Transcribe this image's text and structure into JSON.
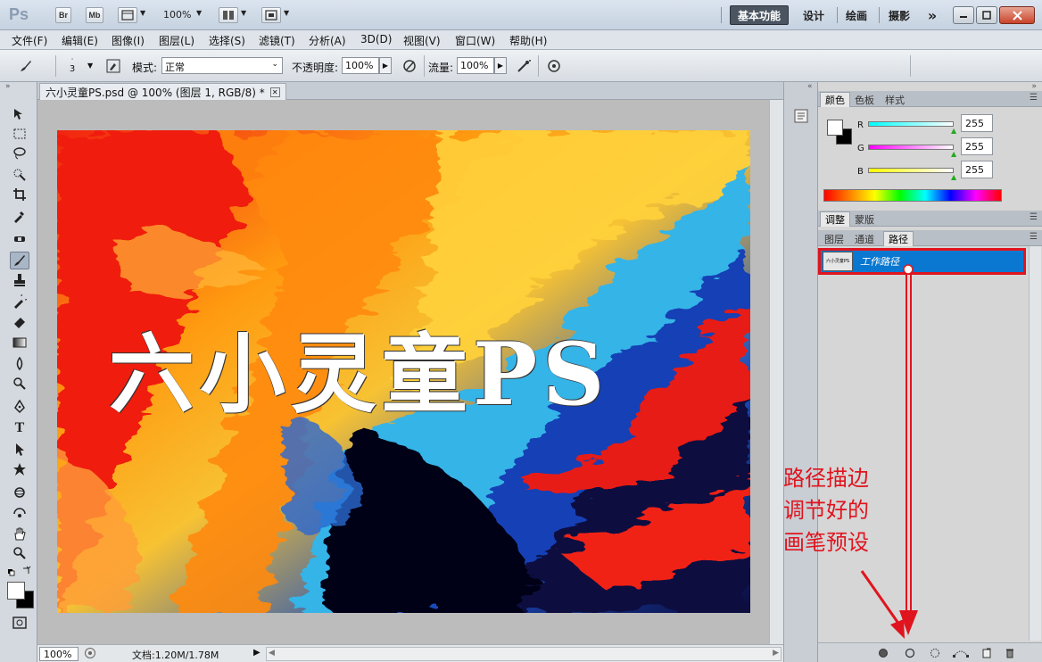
{
  "app": {
    "logo": "Ps",
    "bridge_label": "Br",
    "minibridge_label": "Mb",
    "zoom_top": "100%",
    "workspaces": [
      "基本功能",
      "设计",
      "绘画",
      "摄影"
    ],
    "more_workspaces": "»"
  },
  "menu": [
    "文件(F)",
    "编辑(E)",
    "图像(I)",
    "图层(L)",
    "选择(S)",
    "滤镜(T)",
    "分析(A)",
    "3D(D)",
    "视图(V)",
    "窗口(W)",
    "帮助(H)"
  ],
  "options": {
    "brush_size": "3",
    "mode_label": "模式:",
    "mode_value": "正常",
    "opacity_label": "不透明度:",
    "opacity_value": "100%",
    "flow_label": "流量:",
    "flow_value": "100%"
  },
  "document": {
    "tab_title": "六小灵童PS.psd @ 100% (图层 1, RGB/8) *",
    "canvas_text": "六小灵童PS",
    "zoom": "100%",
    "doc_size": "文档:1.20M/1.78M"
  },
  "color_panel": {
    "tabs": [
      "颜色",
      "色板",
      "样式"
    ],
    "channels": [
      {
        "label": "R",
        "value": "255"
      },
      {
        "label": "G",
        "value": "255"
      },
      {
        "label": "B",
        "value": "255"
      }
    ]
  },
  "adjust_panel": {
    "tabs": [
      "调整",
      "蒙版"
    ]
  },
  "layers_panel": {
    "tabs": [
      "图层",
      "通道",
      "路径"
    ],
    "path_name": "工作路径",
    "thumb_text": "六小灵童PS"
  },
  "annotation": {
    "lines": [
      "路径描边",
      "调节好的",
      "画笔预设"
    ]
  },
  "colors": {
    "annotation_red": "#e0141e",
    "selection_blue": "#0a78d0"
  }
}
